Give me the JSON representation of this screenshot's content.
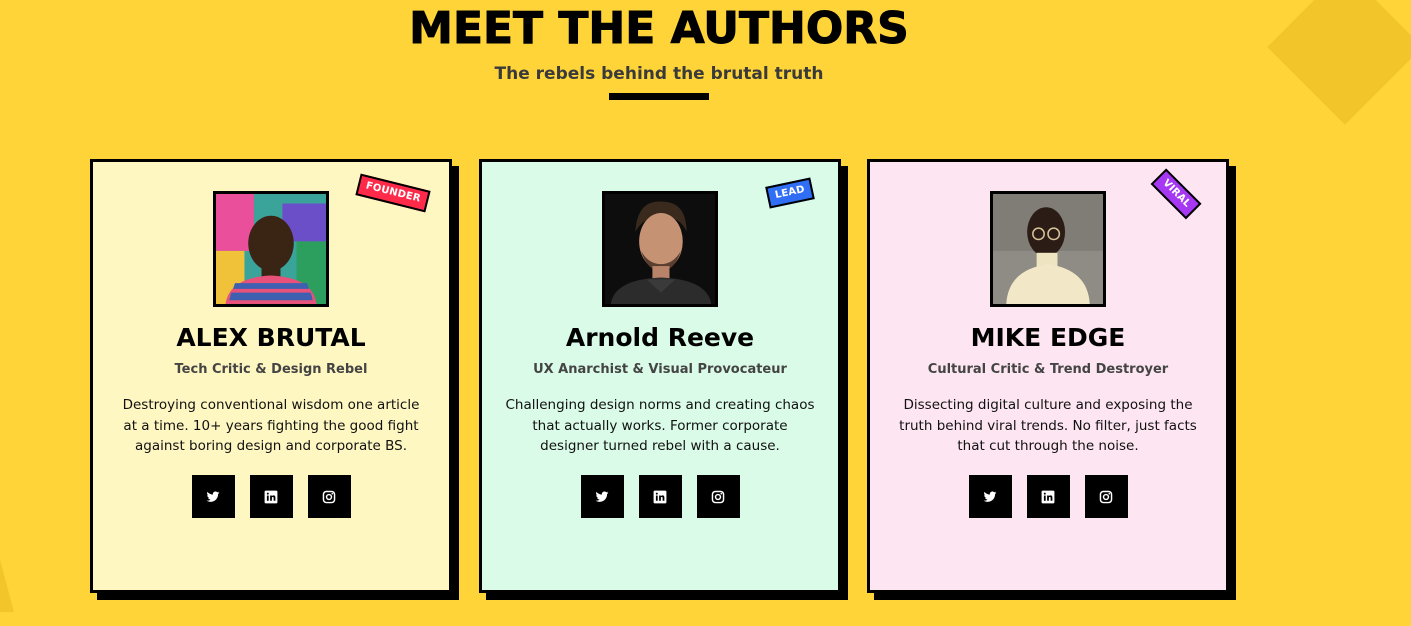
{
  "section": {
    "title": "MEET THE AUTHORS",
    "subtitle": "The rebels behind the brutal truth"
  },
  "authors": [
    {
      "name": "ALEX BRUTAL",
      "role": "Tech Critic & Design Rebel",
      "bio": "Destroying conventional wisdom one article at a time. 10+ years fighting the good fight against boring design and corporate BS.",
      "badge": "FOUNDER",
      "badge_color": "#ff2a4a",
      "card_color": "#fff7c2",
      "socials": [
        "twitter-icon",
        "linkedin-icon",
        "instagram-icon"
      ]
    },
    {
      "name": "Arnold Reeve",
      "role": "UX Anarchist & Visual Provocateur",
      "bio": "Challenging design norms and creating chaos that actually works. Former corporate designer turned rebel with a cause.",
      "badge": "LEAD",
      "badge_color": "#2f6ef5",
      "card_color": "#d9fbe7",
      "socials": [
        "twitter-icon",
        "linkedin-icon",
        "instagram-icon"
      ]
    },
    {
      "name": "MIKE EDGE",
      "role": "Cultural Critic & Trend Destroyer",
      "bio": "Dissecting digital culture and exposing the truth behind viral trends. No filter, just facts that cut through the noise.",
      "badge": "VIRAL",
      "badge_color": "#a637f2",
      "card_color": "#fde6f2",
      "socials": [
        "twitter-icon",
        "linkedin-icon",
        "instagram-icon"
      ]
    }
  ],
  "colors": {
    "background": "#ffd438",
    "accent_shape": "#f2c52b",
    "border": "#000000"
  }
}
